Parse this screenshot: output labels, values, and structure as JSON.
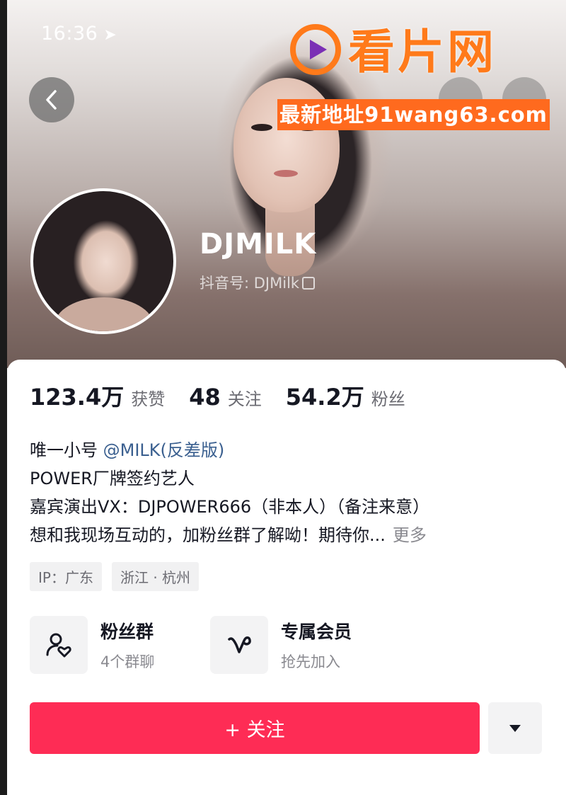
{
  "status_bar": {
    "time": "16:36",
    "location_icon": "location-arrow-icon"
  },
  "watermark": {
    "brand": "看片网",
    "url": "最新地址91wang63.com",
    "color": "#ff7a1a"
  },
  "profile": {
    "username": "DJMILK",
    "douyin_id": "抖音号: DJMilk"
  },
  "stats": [
    {
      "value": "123.4万",
      "label": "获赞"
    },
    {
      "value": "48",
      "label": "关注"
    },
    {
      "value": "54.2万",
      "label": "粉丝"
    }
  ],
  "bio": {
    "line1_prefix": "唯一小号 ",
    "line1_mention": "@MILK(反差版)",
    "line2": "POWER厂牌签约艺人",
    "line3": "嘉宾演出VX：DJPOWER666（非本人）（备注来意）",
    "line4": "想和我现场互动的，加粉丝群了解呦！期待你...",
    "more": "更多"
  },
  "tags": [
    "IP：广东",
    "浙江 · 杭州"
  ],
  "features": [
    {
      "title": "粉丝群",
      "subtitle": "4个群聊",
      "icon": "fan-group-icon"
    },
    {
      "title": "专属会员",
      "subtitle": "抢先加入",
      "icon": "membership-v-icon"
    }
  ],
  "actions": {
    "follow_label": "+ 关注",
    "accent": "#fe2c55"
  }
}
